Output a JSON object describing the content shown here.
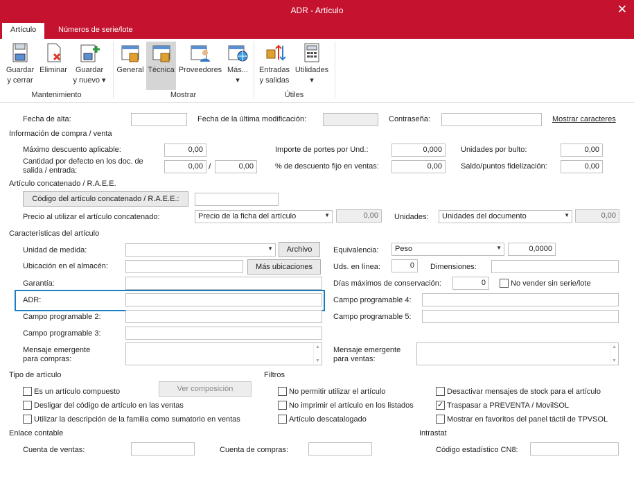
{
  "window": {
    "title": "ADR - Artículo"
  },
  "tabs": [
    {
      "label": "Artículo"
    },
    {
      "label": "Números de serie/lote"
    }
  ],
  "ribbon": {
    "mantenimiento": {
      "group": "Mantenimiento",
      "save_close": "Guardar\ny cerrar",
      "delete": "Eliminar",
      "save_new": "Guardar\ny nuevo ▾"
    },
    "mostrar": {
      "group": "Mostrar",
      "general": "General",
      "tecnica": "Técnica",
      "proveedores": "Proveedores",
      "mas": "Más...\n▾"
    },
    "utiles": {
      "group": "Útiles",
      "entradas": "Entradas\ny salidas",
      "utilidades": "Utilidades\n▾"
    }
  },
  "top": {
    "fecha_alta_label": "Fecha de alta:",
    "fecha_alta": "",
    "fecha_mod_label": "Fecha de la última modificación:",
    "fecha_mod": "",
    "contrasena_label": "Contraseña:",
    "contrasena": "",
    "mostrar_caracteres": "Mostrar caracteres"
  },
  "compra": {
    "section": "Información de compra / venta",
    "max_desc_label": "Máximo descuento aplicable:",
    "max_desc": "0,00",
    "cant_label": "Cantidad por defecto en los doc. de\nsalida / entrada:",
    "cant_salida": "0,00",
    "slash": "/",
    "cant_entrada": "0,00",
    "portes_label": "Importe de portes por Und.:",
    "portes": "0,000",
    "desc_fijo_label": "% de descuento fijo en ventas:",
    "desc_fijo": "0,00",
    "bulto_label": "Unidades por bulto:",
    "bulto": "0,00",
    "saldo_label": "Saldo/puntos fidelización:",
    "saldo": "0,00"
  },
  "concat": {
    "section": "Artículo concatenado / R.A.E.E.",
    "codigo_button": "Código del artículo concatenado / R.A.E.E.:",
    "codigo": "",
    "precio_label": "Precio al utilizar el artículo concatenado:",
    "precio_sel": "Precio de la ficha del artículo",
    "precio_val": "0,00",
    "unidades_label": "Unidades:",
    "unidades_sel": "Unidades del documento",
    "unidades_val": "0,00"
  },
  "caract": {
    "section": "Características del artículo",
    "unidad_label": "Unidad de medida:",
    "unidad": "",
    "archivo_button": "Archivo",
    "ubicacion_label": "Ubicación en el almacén:",
    "ubicacion": "",
    "mas_ubic_button": "Más ubicaciones",
    "garantia_label": "Garantía:",
    "garantia": "",
    "adr_label": "ADR:",
    "adr": "",
    "cp2_label": "Campo programable 2:",
    "cp2": "",
    "cp3_label": "Campo programable 3:",
    "cp3": "",
    "msg_compras_label": "Mensaje emergente\npara compras:",
    "msg_compras": "",
    "equiv_label": "Equivalencia:",
    "equiv_sel": "Peso",
    "equiv_val": "0,0000",
    "uds_linea_label": "Uds. en línea:",
    "uds_linea": "0",
    "dimensiones_label": "Dimensiones:",
    "dimensiones": "",
    "dias_label": "Días máximos de conservación:",
    "dias": "0",
    "no_vender": "No vender sin serie/lote",
    "cp4_label": "Campo programable 4:",
    "cp4": "",
    "cp5_label": "Campo programable 5:",
    "cp5": "",
    "msg_ventas_label": "Mensaje emergente\npara ventas:",
    "msg_ventas": ""
  },
  "tipo": {
    "section": "Tipo de artículo",
    "compuesto": "Es un artículo compuesto",
    "ver_comp_button": "Ver composición",
    "desligar": "Desligar del código de artículo en las ventas",
    "utilizar_desc": "Utilizar la descripción de la familia como sumatorio en ventas"
  },
  "filtros": {
    "section": "Filtros",
    "no_permitir": "No permitir utilizar el artículo",
    "no_imprimir": "No imprimir el artículo en los listados",
    "descatalogado": "Artículo descatalogado",
    "desactivar": "Desactivar mensajes de stock para el artículo",
    "traspasar": "Traspasar a PREVENTA / MovilSOL",
    "favoritos": "Mostrar en favoritos del panel táctil de TPVSOL",
    "check_mark": "✓"
  },
  "contable": {
    "section": "Enlace contable",
    "ventas_label": "Cuenta de ventas:",
    "ventas": "",
    "compras_label": "Cuenta de compras:",
    "compras": ""
  },
  "intrastat": {
    "section": "Intrastat",
    "cn8_label": "Código estadístico CN8:",
    "cn8": ""
  },
  "colors": {
    "brand": "#c4122f",
    "focus": "#1a7fc2"
  }
}
